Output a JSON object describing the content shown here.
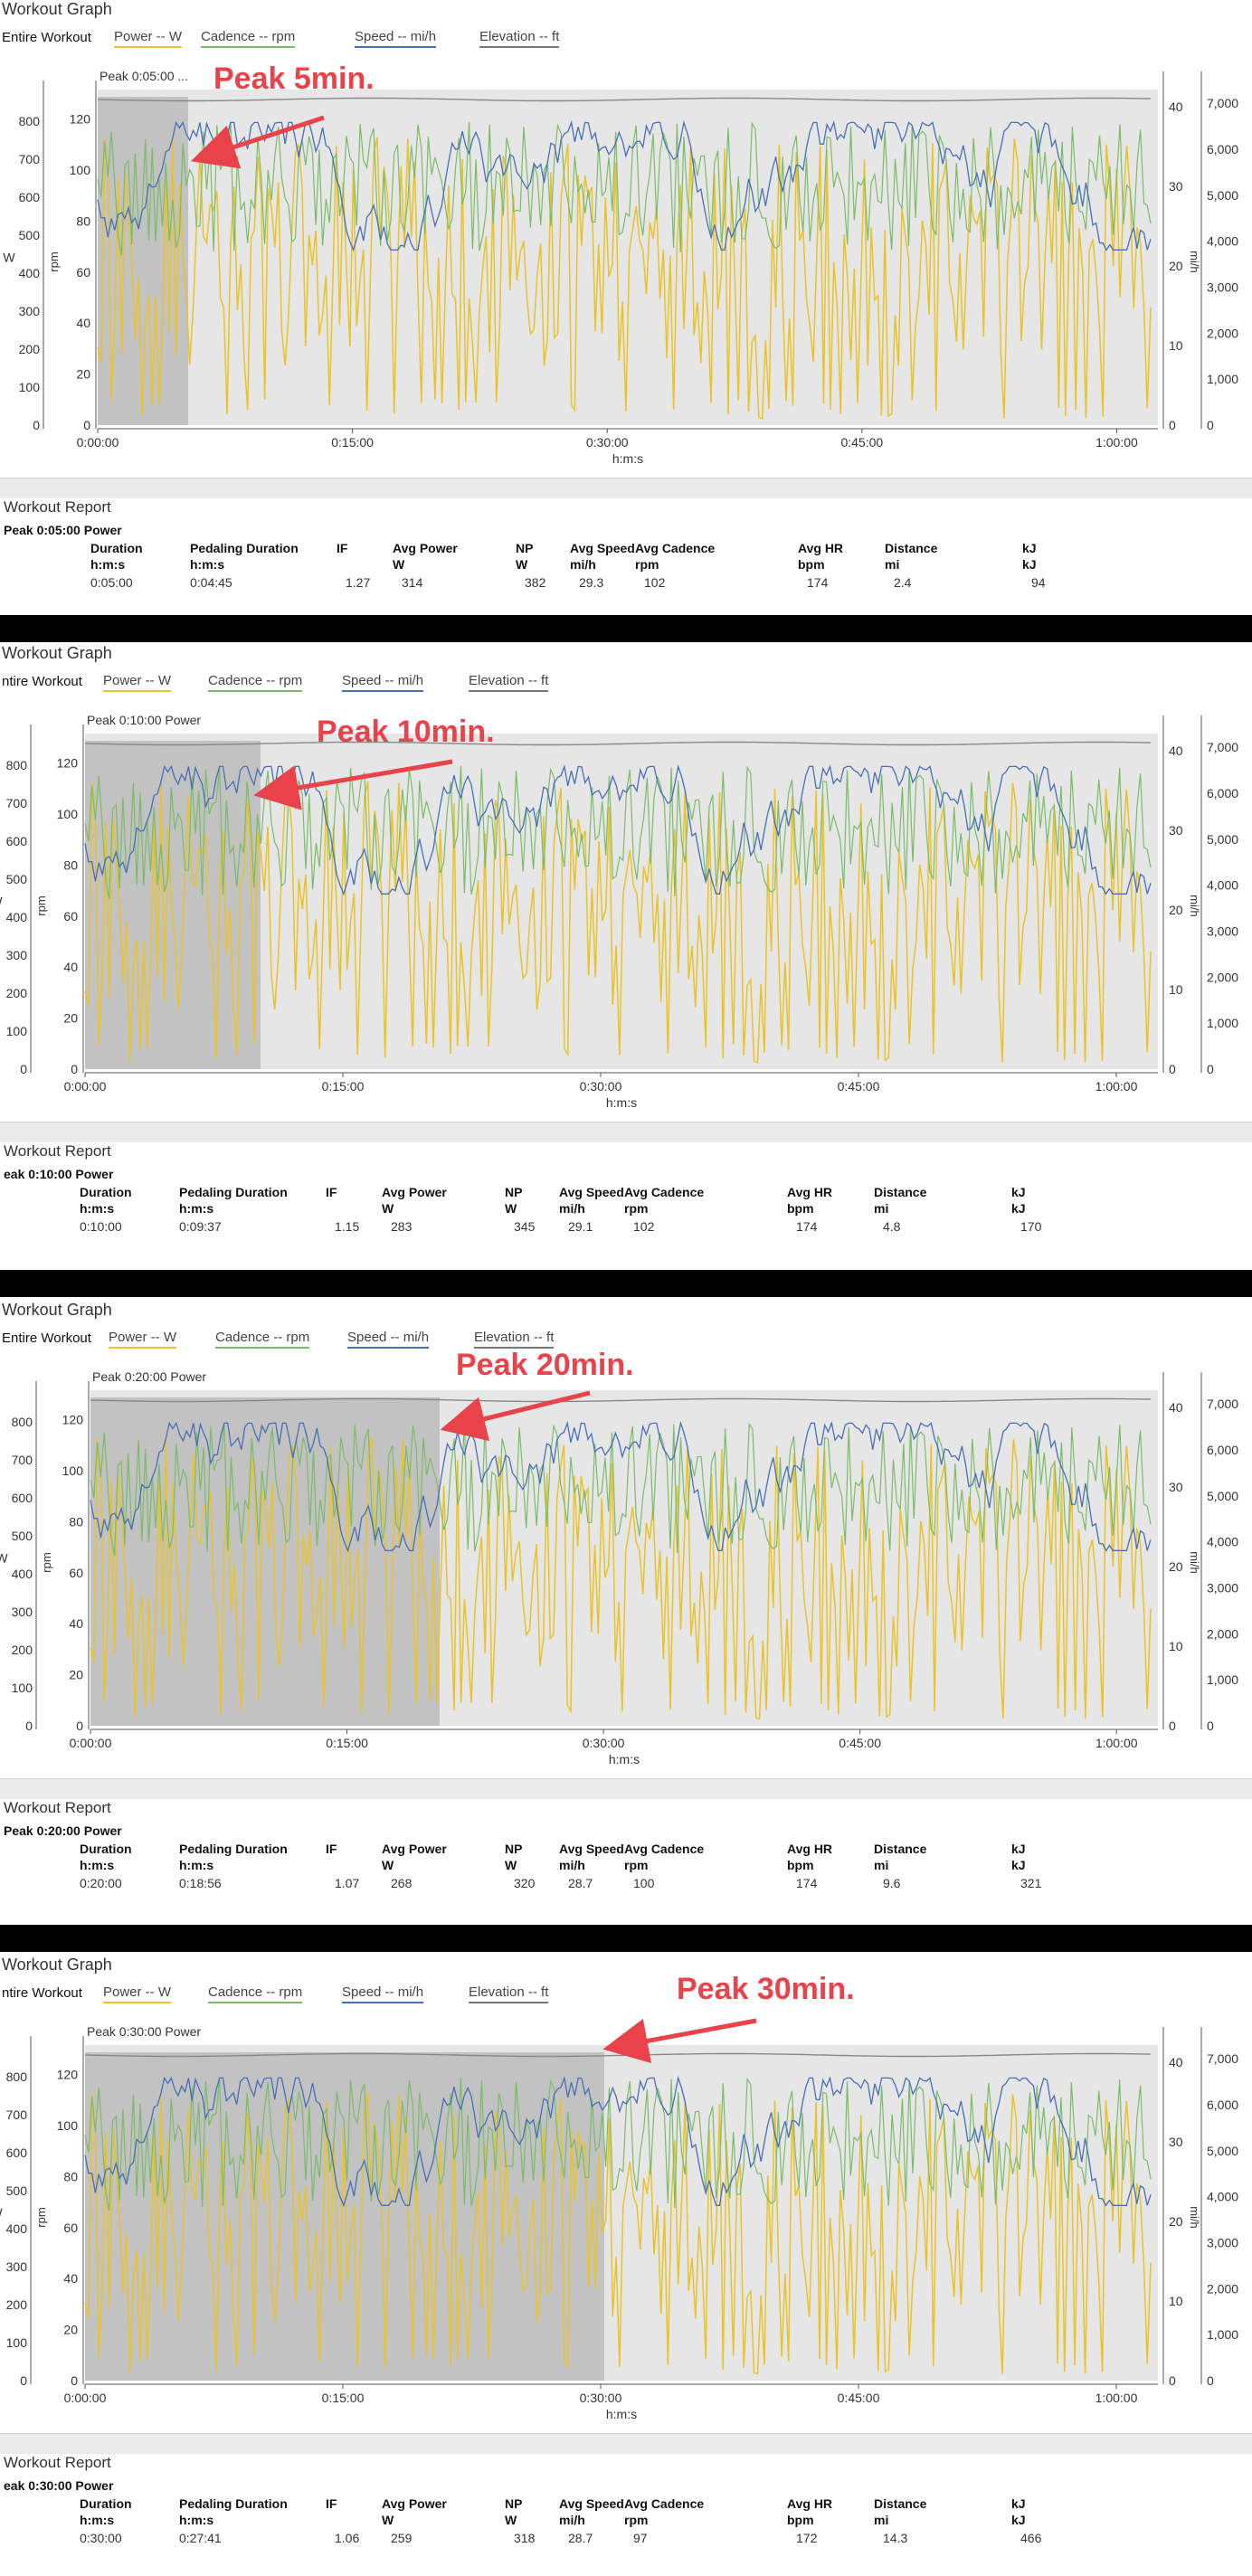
{
  "legend": [
    {
      "label": "Power  -- W",
      "color": "#e8c32a"
    },
    {
      "label": "Cadence  -- rpm",
      "color": "#7dbb6a"
    },
    {
      "label": "Speed  -- mi/h",
      "color": "#4a6fb5"
    },
    {
      "label": "Elevation  -- ft",
      "color": "#777777"
    }
  ],
  "headers": [
    [
      "Duration",
      "h:m:s"
    ],
    [
      "Pedaling Duration",
      "h:m:s"
    ],
    [
      "IF",
      ""
    ],
    [
      "Avg Power",
      "W"
    ],
    [
      "NP",
      "W"
    ],
    [
      "Avg Speed",
      "mi/h"
    ],
    [
      "Avg Cadence",
      "rpm"
    ],
    [
      "Avg HR",
      "bpm"
    ],
    [
      "Distance",
      "mi"
    ],
    [
      "kJ",
      "kJ"
    ]
  ],
  "panels": [
    {
      "graph_title": "Workout Graph",
      "entire_label": "Entire Workout",
      "peak_label": "Peak 0:05:00 ...",
      "annotation": "Peak 5min.",
      "report_title": "Workout Report",
      "report_subtitle": "Peak 0:05:00 Power",
      "values": [
        "0:05:00",
        "0:04:45",
        "1.27",
        "314",
        "382",
        "29.3",
        "102",
        "174",
        "2.4",
        "94"
      ]
    },
    {
      "graph_title": "Workout Graph",
      "entire_label": "ntire Workout",
      "peak_label": "Peak 0:10:00 Power",
      "annotation": "Peak 10min.",
      "report_title": "Workout Report",
      "report_subtitle": "eak 0:10:00 Power",
      "values": [
        "0:10:00",
        "0:09:37",
        "1.15",
        "283",
        "345",
        "29.1",
        "102",
        "174",
        "4.8",
        "170"
      ]
    },
    {
      "graph_title": "Workout Graph",
      "entire_label": "Entire Workout",
      "peak_label": "Peak 0:20:00 Power",
      "annotation": "Peak 20min.",
      "report_title": "Workout Report",
      "report_subtitle": "Peak 0:20:00 Power",
      "values": [
        "0:20:00",
        "0:18:56",
        "1.07",
        "268",
        "320",
        "28.7",
        "100",
        "174",
        "9.6",
        "321"
      ]
    },
    {
      "graph_title": "Workout Graph",
      "entire_label": "ntire Workout",
      "peak_label": "Peak 0:30:00 Power",
      "annotation": "Peak 30min.",
      "report_title": "Workout Report",
      "report_subtitle": "eak 0:30:00 Power",
      "values": [
        "0:30:00",
        "0:27:41",
        "1.06",
        "259",
        "318",
        "28.7",
        "97",
        "172",
        "14.3",
        "466"
      ]
    }
  ],
  "chart_data": [
    {
      "type": "line",
      "x_label": "h:m:s",
      "x_ticks": [
        "0:00:00",
        "0:15:00",
        "0:30:00",
        "0:45:00",
        "1:00:00"
      ],
      "x_range_min": [
        0,
        62
      ],
      "y_axes": [
        {
          "unit": "W",
          "ticks": [
            0,
            100,
            200,
            300,
            400,
            500,
            600,
            700,
            800
          ]
        },
        {
          "unit": "rpm",
          "ticks": [
            0,
            20,
            40,
            60,
            80,
            100,
            120
          ]
        },
        {
          "unit": "mi/h",
          "ticks": [
            0,
            10,
            20,
            30,
            40
          ]
        },
        {
          "unit": "ft",
          "ticks": [
            "0",
            "1,000",
            "2,000",
            "3,000",
            "4,000",
            "5,000",
            "6,000",
            "7,000"
          ]
        }
      ],
      "series": [
        {
          "name": "Power",
          "unit": "W",
          "color": "#e8c32a",
          "typical_range": [
            0,
            860
          ]
        },
        {
          "name": "Cadence",
          "unit": "rpm",
          "color": "#7dbb6a",
          "typical_range": [
            20,
            120
          ]
        },
        {
          "name": "Speed",
          "unit": "mi/h",
          "color": "#4a6fb5",
          "typical_range": [
            20,
            40
          ]
        },
        {
          "name": "Elevation",
          "unit": "ft",
          "color": "#777777",
          "typical_range": [
            6800,
            7000
          ]
        }
      ],
      "highlight_minutes": [
        0,
        5
      ]
    },
    {
      "type": "line",
      "x_label": "h:m:s",
      "x_ticks": [
        "0:00:00",
        "0:15:00",
        "0:30:00",
        "0:45:00",
        "1:00:00"
      ],
      "highlight_minutes": [
        0,
        10
      ]
    },
    {
      "type": "line",
      "x_label": "h:m:s",
      "x_ticks": [
        "0:00:00",
        "0:15:00",
        "0:30:00",
        "0:45:00",
        "1:00:00"
      ],
      "highlight_minutes": [
        0,
        20
      ]
    },
    {
      "type": "line",
      "x_label": "h:m:s",
      "x_ticks": [
        "0:00:00",
        "0:15:00",
        "0:30:00",
        "0:45:00",
        "1:00:00"
      ],
      "highlight_minutes": [
        0,
        30
      ]
    }
  ]
}
